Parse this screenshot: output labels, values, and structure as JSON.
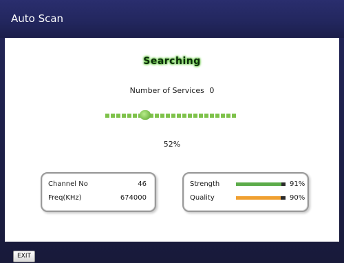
{
  "title": "Auto Scan",
  "status": "Searching",
  "services": {
    "label": "Number of Services",
    "count": "0"
  },
  "progress": {
    "percent_text": "52%",
    "fraction": 0.3
  },
  "channel_info": {
    "channel_label": "Channel No",
    "channel_value": "46",
    "freq_label": "Freq(KHz)",
    "freq_value": "674000"
  },
  "signal": {
    "strength_label": "Strength",
    "strength_value": "91%",
    "strength_level": 0.91,
    "strength_color": "#5cab4a",
    "quality_label": "Quality",
    "quality_value": "90%",
    "quality_level": 0.9,
    "quality_color": "#f0a030"
  },
  "footer": {
    "exit_label": "EXIT"
  },
  "colors": {
    "header": "#262a66",
    "progress": "#7ec24a",
    "background": "#1b1e44"
  }
}
